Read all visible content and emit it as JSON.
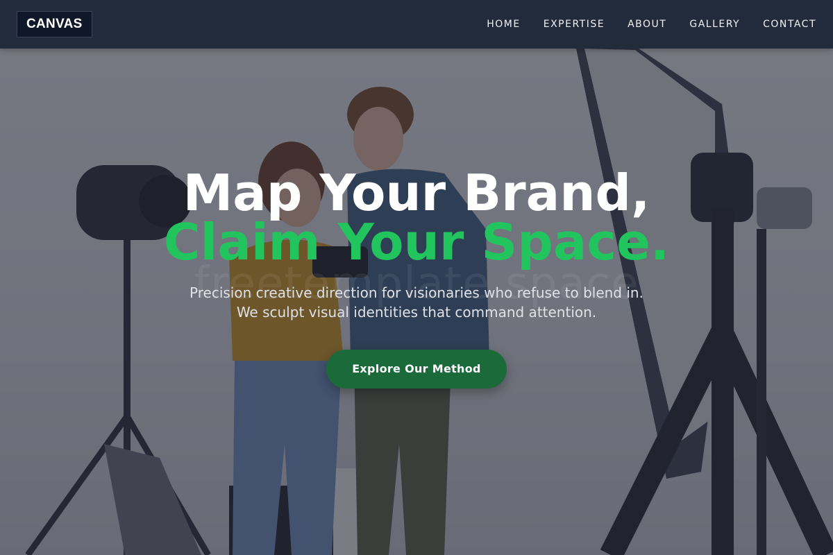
{
  "navbar": {
    "logo": "CANVAS",
    "links": [
      "HOME",
      "EXPERTISE",
      "ABOUT",
      "GALLERY",
      "CONTACT"
    ]
  },
  "hero": {
    "headline_line1": "Map Your Brand,",
    "headline_line2": "Claim Your Space.",
    "watermark": "freetemplate.space",
    "subtitle_line1": "Precision creative direction for visionaries who refuse to blend in.",
    "subtitle_line2": "We sculpt visual identities that command attention.",
    "cta_label": "Explore Our Method",
    "background": "photo-studio-image"
  },
  "colors": {
    "navbar_bg": "#222b3c",
    "logo_bg": "#0f1728",
    "accent_green": "#21c45d",
    "cta_bg": "#1b6a3a",
    "text_white": "#ffffff"
  }
}
